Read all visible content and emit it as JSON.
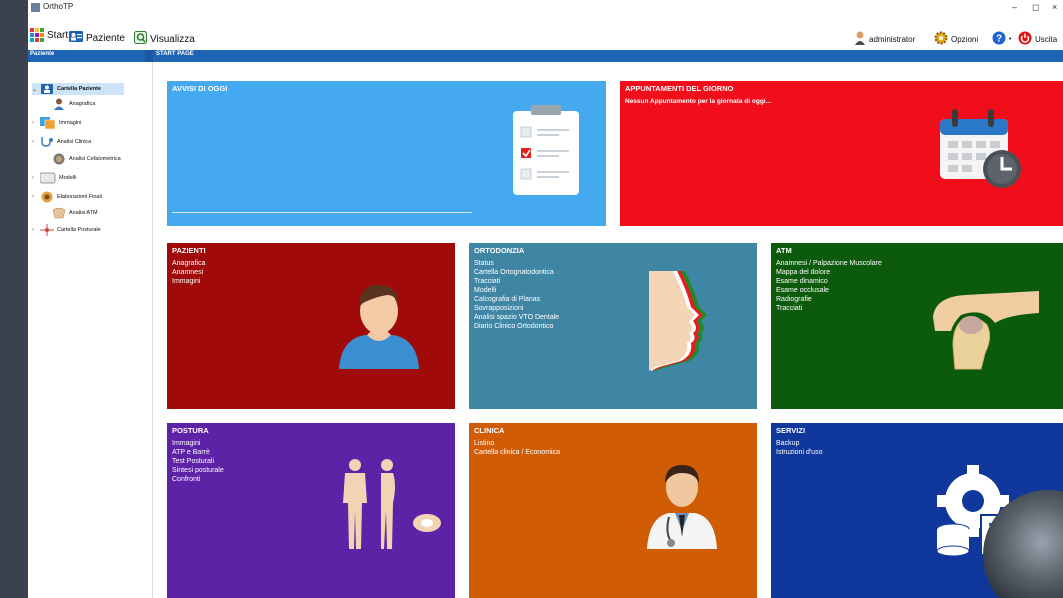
{
  "window": {
    "title": "OrthoTP"
  },
  "toolbar": {
    "start_label": "Start",
    "paziente_label": "Paziente",
    "visualizza_label": "Visualizza",
    "user_label": "administrator",
    "opzioni_label": "Opzioni",
    "uscita_label": "Uscita"
  },
  "header": {
    "left_label": "Paziente",
    "right_label": "START PAGE"
  },
  "sidebar": {
    "items": [
      {
        "label": "Cartella Paziente",
        "icon": "patient-card-icon",
        "expander": "⌄"
      },
      {
        "label": "Anagrafica",
        "icon": "person-icon",
        "expander": ""
      },
      {
        "label": "Immagini",
        "icon": "images-icon",
        "expander": "›"
      },
      {
        "label": "Analisi Clinica",
        "icon": "stethoscope-icon",
        "expander": "›"
      },
      {
        "label": "Analisi Cefalometrica",
        "icon": "cephalometric-icon",
        "expander": ""
      },
      {
        "label": "Modelli",
        "icon": "models-icon",
        "expander": "›"
      },
      {
        "label": "Elaborazioni Finali",
        "icon": "final-processing-icon",
        "expander": "›"
      },
      {
        "label": "Analisi ATM",
        "icon": "atm-icon",
        "expander": ""
      },
      {
        "label": "Cartella Posturale",
        "icon": "postural-icon",
        "expander": "›"
      }
    ]
  },
  "tiles": {
    "avvisi": {
      "title": "AVVISI DI OGGI",
      "color": "#45a9f0"
    },
    "appuntamenti": {
      "title": "APPUNTAMENTI DEL GIORNO",
      "message": "Nessun Appuntamento per la giornata di oggi...",
      "color": "#f10d1a"
    },
    "pazienti": {
      "title": "PAZIENTI",
      "items": [
        "Anagrafica",
        "Anamnesi",
        "Immagini"
      ],
      "color": "#a00a0a"
    },
    "ortodonzia": {
      "title": "ORTODONZIA",
      "items": [
        "Status",
        "Cartella Ortognatodontica",
        "Tracciati",
        "Modelli",
        "Calcografia di Planas",
        "Sovrapposizioni",
        "Analisi spazio VTO Dentale",
        "Diario Clinico Ortodontico"
      ],
      "color": "#3f86a5"
    },
    "atm": {
      "title": "ATM",
      "items": [
        "Anamnesi / Palpazione Muscolare",
        "Mappa del dolore",
        "Esame dinamico",
        "Esame occlusale",
        "Radiografie",
        "Tracciati"
      ],
      "color": "#0c5a0c"
    },
    "postura": {
      "title": "POSTURA",
      "items": [
        "Immagini",
        "ATP e Barrè",
        "Test Posturali",
        "Sintesi posturale",
        "Confronti"
      ],
      "color": "#5e22a6"
    },
    "clinica": {
      "title": "CLINICA",
      "items": [
        "Listino",
        "Cartella clinica / Economica"
      ],
      "color": "#d05d06"
    },
    "servizi": {
      "title": "SERVIZI",
      "items": [
        "Backup",
        "Istruzioni d'uso"
      ],
      "color": "#10379b"
    }
  }
}
